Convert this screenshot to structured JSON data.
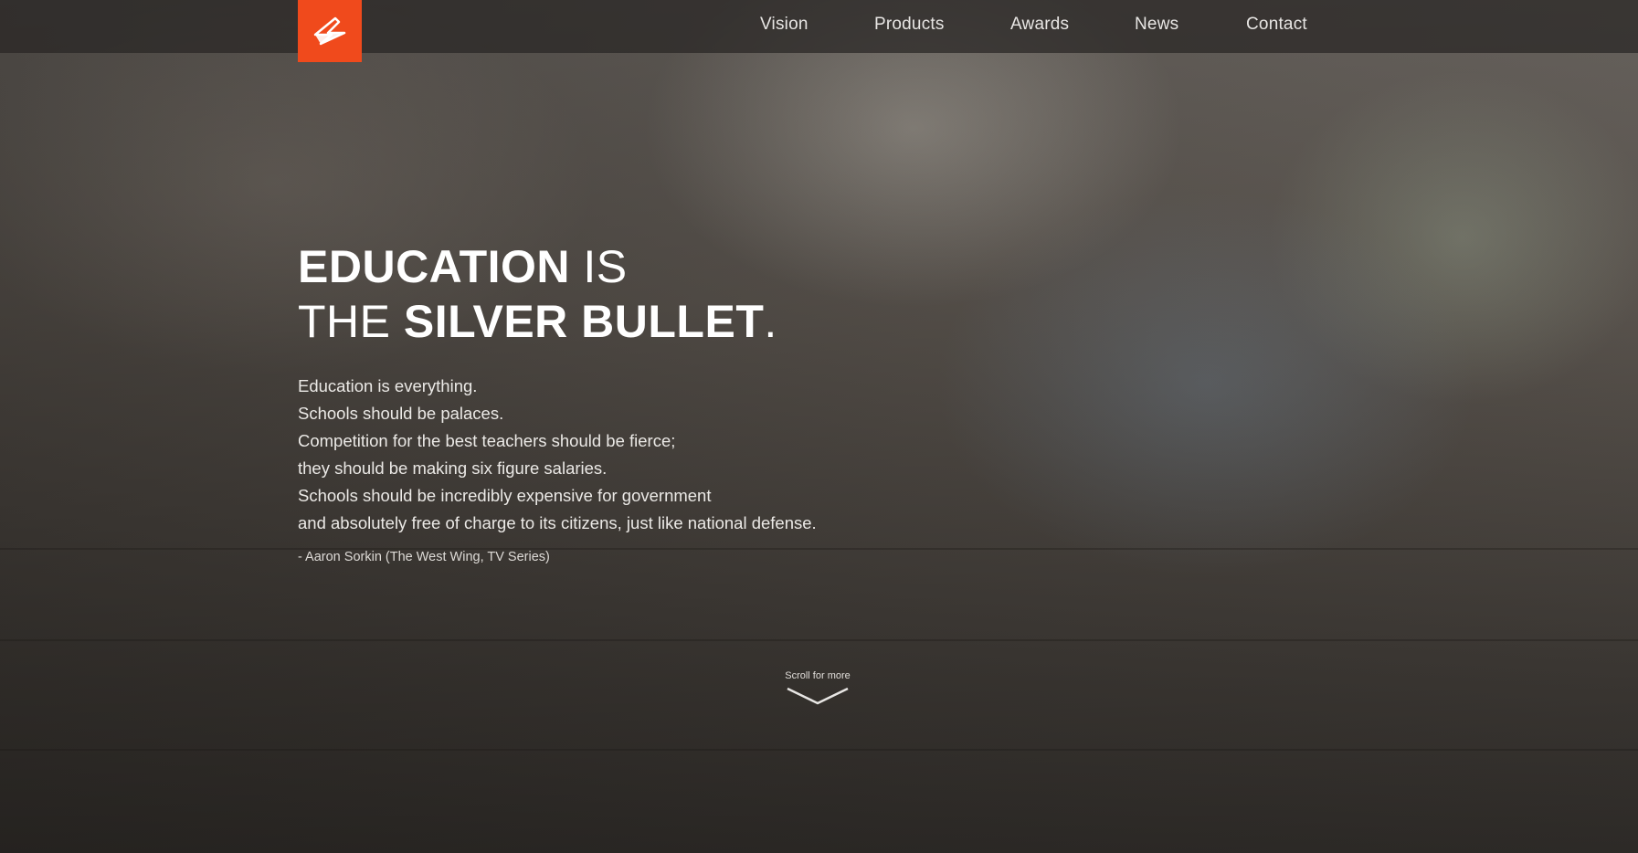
{
  "nav": {
    "items": [
      {
        "label": "Vision"
      },
      {
        "label": "Products"
      },
      {
        "label": "Awards"
      },
      {
        "label": "News"
      },
      {
        "label": "Contact"
      }
    ]
  },
  "logo": {
    "icon": "lightning-bolt-icon",
    "color": "#f04a1c"
  },
  "hero": {
    "headline_line1_bold": "EDUCATION",
    "headline_line1_light": " IS",
    "headline_line2_light": "THE ",
    "headline_line2_bold": "SILVER BULLET",
    "headline_line2_end": ".",
    "quote_lines": [
      "Education is everything.",
      "Schools should be palaces.",
      "Competition for the best teachers should be fierce;",
      "they should be making six figure salaries.",
      "Schools should be incredibly expensive for government",
      "and absolutely free of charge to its citizens, just like national defense."
    ],
    "attribution": "- Aaron Sorkin (The West Wing, TV Series)"
  },
  "scroll": {
    "label": "Scroll for more",
    "icon": "chevron-down-icon"
  }
}
